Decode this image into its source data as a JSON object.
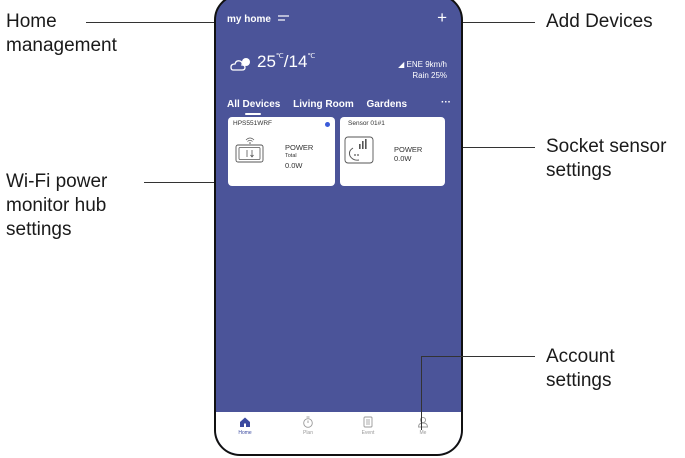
{
  "callouts": {
    "home_management": [
      "Home",
      "management"
    ],
    "add_devices": "Add Devices",
    "socket_sensor": [
      "Socket sensor",
      "settings"
    ],
    "wifi_hub": [
      "Wi-Fi power",
      "monitor hub",
      "settings"
    ],
    "account": [
      "Account",
      "settings"
    ]
  },
  "app": {
    "home_name": "my home",
    "menu_icon": "menu-icon",
    "add_icon": "+",
    "weather": {
      "icon": "cloudy-icon",
      "high": "25",
      "low": "14",
      "unit": "℃",
      "wind": "ENE 9km/h",
      "rain": "Rain 25%"
    },
    "tabs": [
      "All Devices",
      "Living Room",
      "Gardens",
      "···"
    ],
    "devices": [
      {
        "name": "HPS551WRF",
        "icon": "hub-icon",
        "power_label": "POWER",
        "sub_label": "Total",
        "value": "0.0W",
        "online": true
      },
      {
        "name": "Sensor 01#1",
        "icon": "socket-sensor-icon",
        "power_label": "POWER",
        "value": "0.0W"
      }
    ],
    "nav": [
      {
        "label": "Home",
        "icon": "home-icon",
        "active": true
      },
      {
        "label": "Plan",
        "icon": "timer-icon"
      },
      {
        "label": "Event",
        "icon": "event-icon"
      },
      {
        "label": "Me",
        "icon": "user-icon"
      }
    ]
  },
  "colors": {
    "app_background": "#4b5499",
    "accent": "#3b4aa0",
    "online_dot": "#3a5bd9"
  }
}
